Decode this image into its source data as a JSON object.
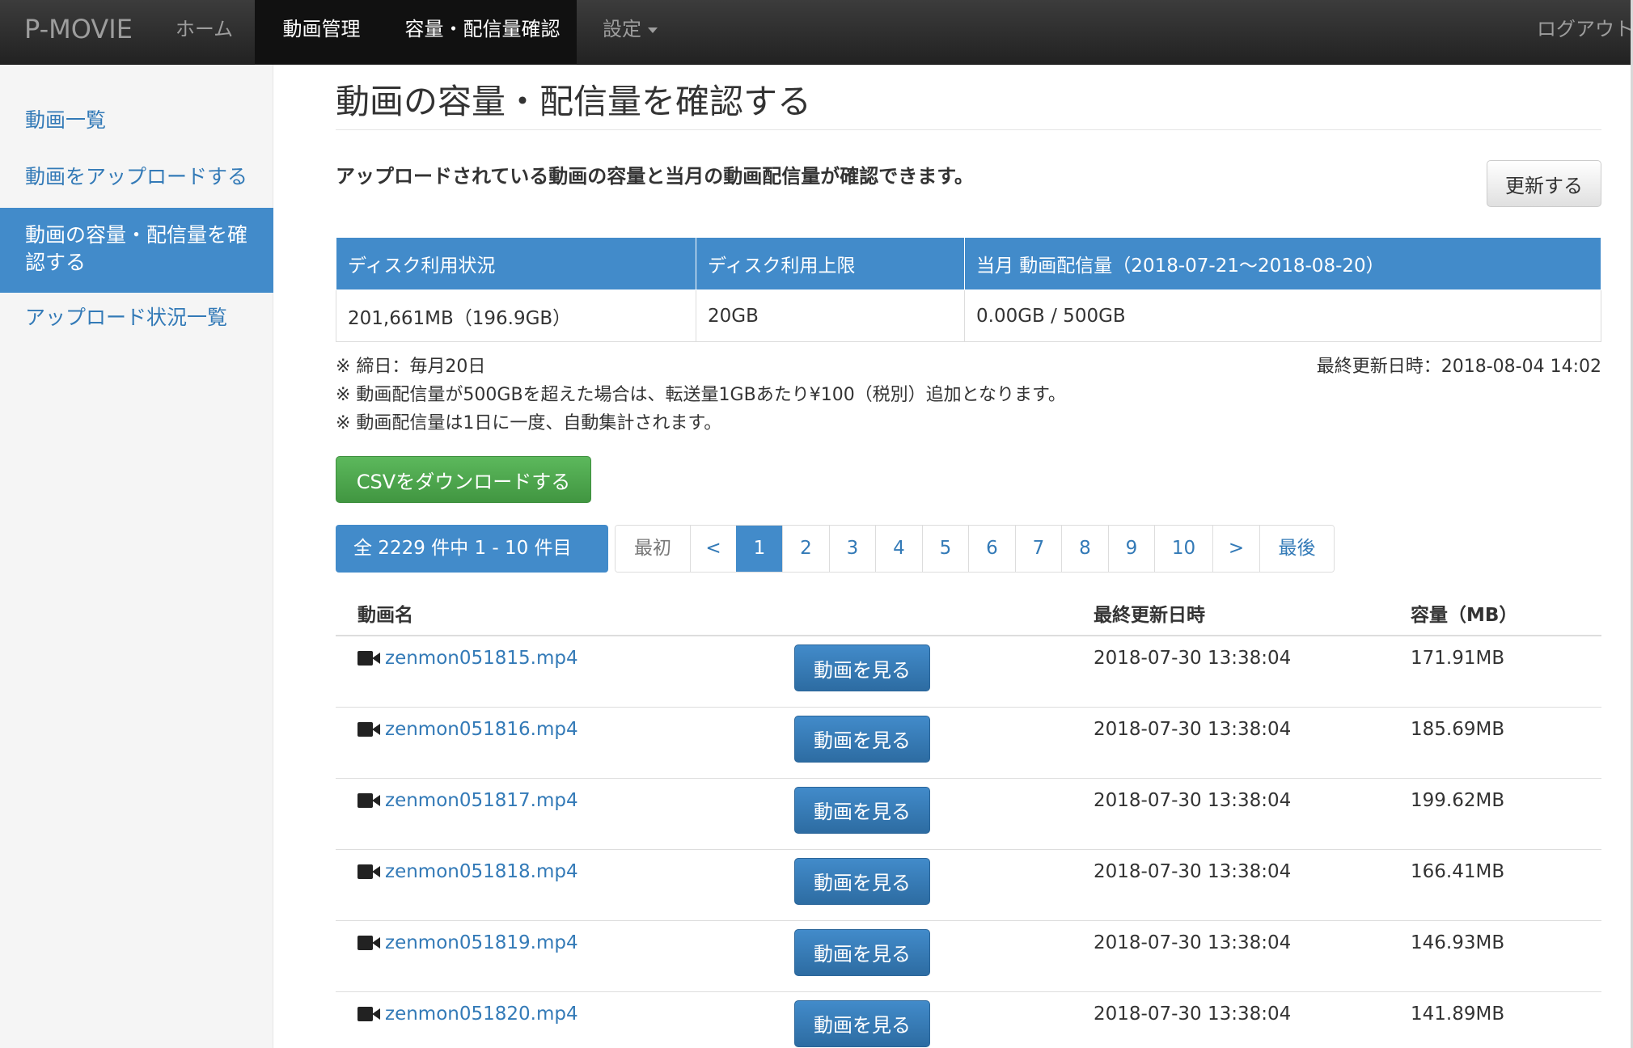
{
  "navbar": {
    "brand": "P-MOVIE",
    "home": "ホーム",
    "manage": "動画管理",
    "capacity": "容量・配信量確認",
    "settings": "設定",
    "logout": "ログアウト"
  },
  "sidebar": {
    "items": [
      {
        "label": "動画一覧"
      },
      {
        "label": "動画をアップロードする"
      },
      {
        "label": "動画の容量・配信量を確認する"
      },
      {
        "label": "アップロード状況一覧"
      }
    ]
  },
  "page": {
    "title": "動画の容量・配信量を確認する",
    "description": "アップロードされている動画の容量と当月の動画配信量が確認できます。",
    "refresh_label": "更新する"
  },
  "stats": {
    "headers": [
      "ディスク利用状況",
      "ディスク利用上限",
      "当月 動画配信量（2018-07-21〜2018-08-20）"
    ],
    "values": [
      "201,661MB（196.9GB）",
      "20GB",
      "0.00GB / 500GB"
    ]
  },
  "notes": [
    "※ 締日：毎月20日",
    "※ 動画配信量が500GBを超えた場合は、転送量1GBあたり¥100（税別）追加となります。",
    "※ 動画配信量は1日に一度、自動集計されます。"
  ],
  "last_updated": "最終更新日時：2018-08-04 14:02",
  "csv_label": "CSVをダウンロードする",
  "count_label": "全 2229 件中 1 - 10 件目",
  "pagination": {
    "first": "最初",
    "prev": "<",
    "pages": [
      "1",
      "2",
      "3",
      "4",
      "5",
      "6",
      "7",
      "8",
      "9",
      "10"
    ],
    "current": "1",
    "next": ">",
    "last": "最後"
  },
  "videos": {
    "headers": {
      "name": "動画名",
      "date": "最終更新日時",
      "size": "容量（MB）"
    },
    "view_label": "動画を見る",
    "icon": "video-camera-icon",
    "rows": [
      {
        "name": "zenmon051815.mp4",
        "date": "2018-07-30 13:38:04",
        "size": "171.91MB"
      },
      {
        "name": "zenmon051816.mp4",
        "date": "2018-07-30 13:38:04",
        "size": "185.69MB"
      },
      {
        "name": "zenmon051817.mp4",
        "date": "2018-07-30 13:38:04",
        "size": "199.62MB"
      },
      {
        "name": "zenmon051818.mp4",
        "date": "2018-07-30 13:38:04",
        "size": "166.41MB"
      },
      {
        "name": "zenmon051819.mp4",
        "date": "2018-07-30 13:38:04",
        "size": "146.93MB"
      },
      {
        "name": "zenmon051820.mp4",
        "date": "2018-07-30 13:38:04",
        "size": "141.89MB"
      }
    ]
  }
}
